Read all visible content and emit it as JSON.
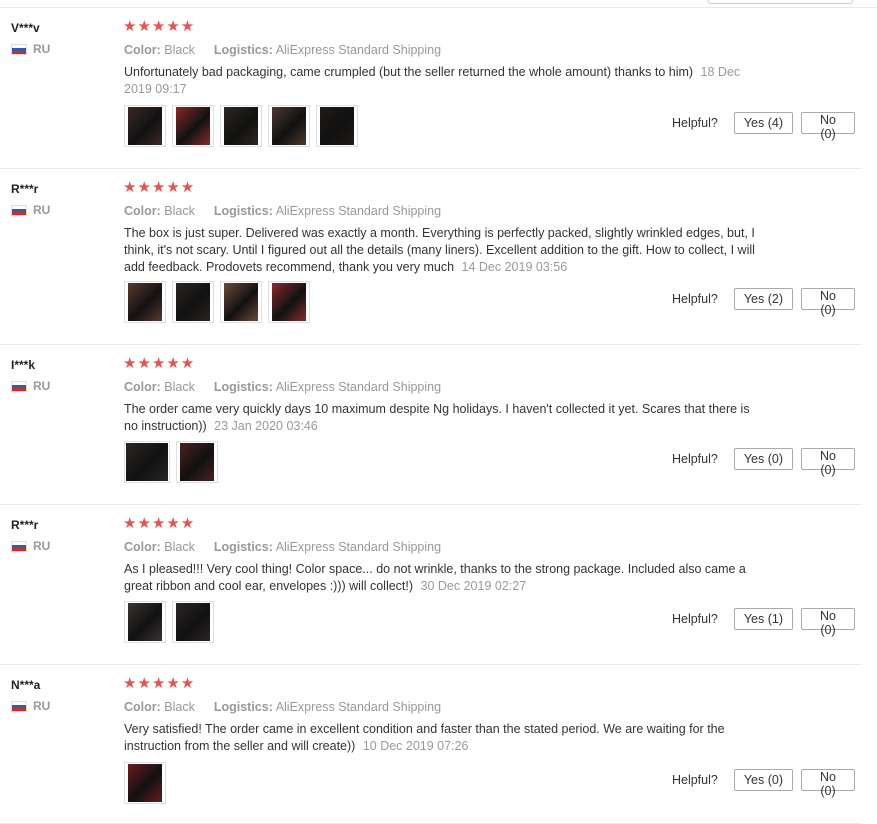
{
  "labels": {
    "color": "Color:",
    "logistics": "Logistics:",
    "helpful": "Helpful?",
    "stars": "★★★★★"
  },
  "colors": {
    "star": "#f04f4f",
    "muted": "#999999",
    "flag": [
      "#ffffff",
      "#2c5ab8",
      "#d52b1e"
    ]
  },
  "reviews": [
    {
      "user": "V***v",
      "country": "RU",
      "rating": 5,
      "color": "Black",
      "logistics": "AliExpress Standard Shipping",
      "text": "Unfortunately bad packaging, came crumpled (but the seller returned the whole amount) thanks to him)",
      "date": "18 Dec 2019 09:17",
      "yes": "Yes (4)",
      "no": "No (0)",
      "photos": 5
    },
    {
      "user": "R***r",
      "country": "RU",
      "rating": 5,
      "color": "Black",
      "logistics": "AliExpress Standard Shipping",
      "text": "The box is just super. Delivered was exactly a month. Everything is perfectly packed, slightly wrinkled edges, but, I think, it's not scary. Until I figured out all the details (many liners). Excellent addition to the gift. How to collect, I will add feedback. Prodovets recommend, thank you very much",
      "date": "14 Dec 2019 03:56",
      "yes": "Yes (2)",
      "no": "No (0)",
      "photos": 4
    },
    {
      "user": "I***k",
      "country": "RU",
      "rating": 5,
      "color": "Black",
      "logistics": "AliExpress Standard Shipping",
      "text": "The order came very quickly days 10 maximum despite Ng holidays. I haven't collected it yet. Scares that there is no instruction))",
      "date": "23 Jan 2020 03:46",
      "yes": "Yes (0)",
      "no": "No (0)",
      "photos": 2
    },
    {
      "user": "R***r",
      "country": "RU",
      "rating": 5,
      "color": "Black",
      "logistics": "AliExpress Standard Shipping",
      "text": "As I pleased!!! Very cool thing! Color space... do not wrinkle, thanks to the strong package. Included also came a great ribbon and cool ear, envelopes :))) will collect!)",
      "date": "30 Dec 2019 02:27",
      "yes": "Yes (1)",
      "no": "No (0)",
      "photos": 2
    },
    {
      "user": "N***a",
      "country": "RU",
      "rating": 5,
      "color": "Black",
      "logistics": "AliExpress Standard Shipping",
      "text": "Very satisfied! The order came in excellent condition and faster than the stated period. We are waiting for the instruction from the seller and will create))",
      "date": "10 Dec 2019 07:26",
      "yes": "Yes (0)",
      "no": "No (0)",
      "photos": 1
    }
  ]
}
